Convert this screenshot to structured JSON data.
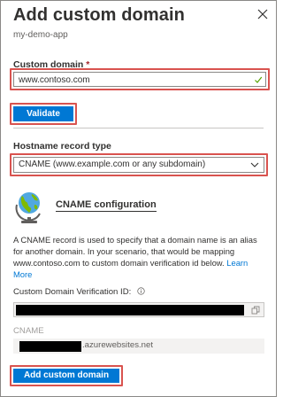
{
  "panel": {
    "title": "Add custom domain",
    "subtitle": "my-demo-app"
  },
  "custom_domain": {
    "label": "Custom domain",
    "required_marker": "*",
    "value": "www.contoso.com",
    "status_icon": "check-icon"
  },
  "validate_button": {
    "label": "Validate"
  },
  "hostname_record": {
    "label": "Hostname record type",
    "selected": "CNAME (www.example.com or any subdomain)"
  },
  "cname_config": {
    "heading": "CNAME configuration",
    "description": "A CNAME record is used to specify that a domain name is an alias for another domain. In your scenario, that would be mapping www.contoso.com to custom domain verification id below.",
    "learn_more": "Learn More"
  },
  "verification": {
    "label": "Custom Domain Verification ID:",
    "value": ""
  },
  "cname": {
    "label": "CNAME",
    "suffix": ".azurewebsites.net"
  },
  "add_button": {
    "label": "Add custom domain"
  },
  "colors": {
    "accent": "#0078d4",
    "highlight": "#d9534f",
    "success": "#57a300"
  }
}
